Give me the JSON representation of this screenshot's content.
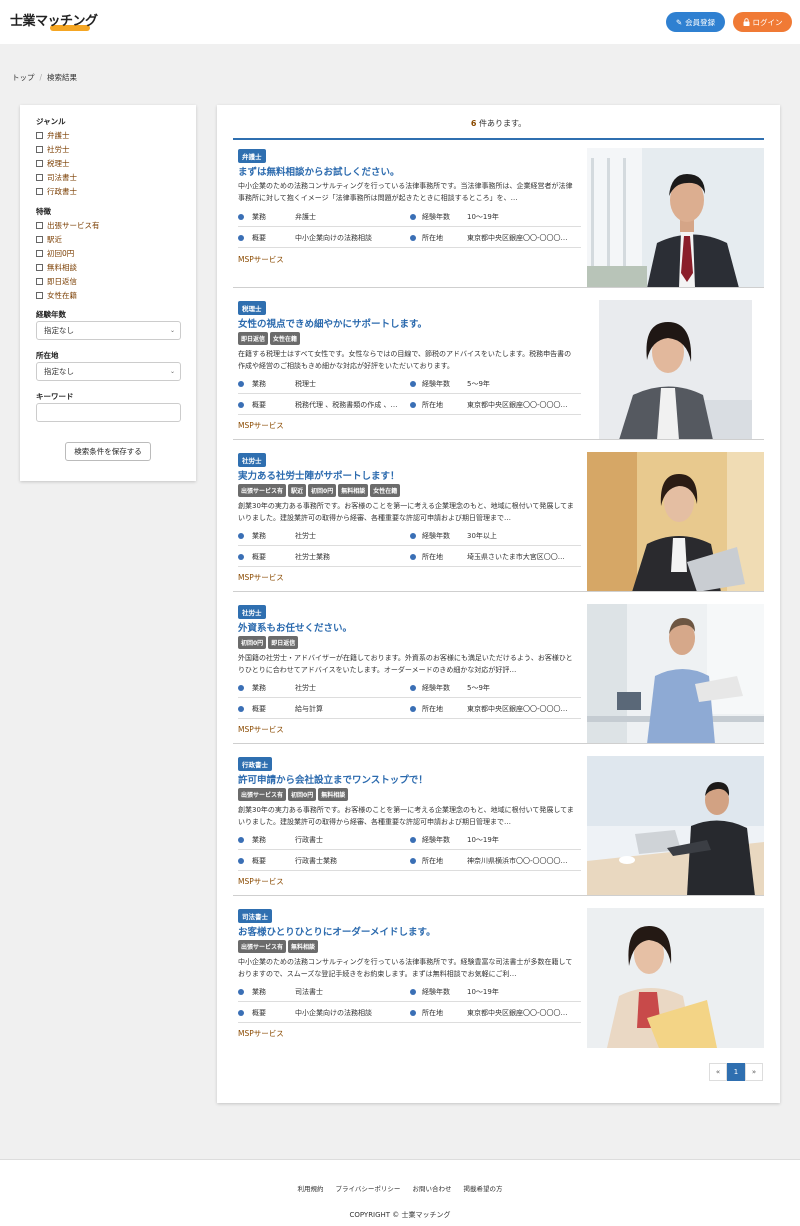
{
  "header": {
    "logo_text": "士業マッチング",
    "register_label": "会員登録",
    "login_label": "ログイン",
    "brand_color": "#f5a623"
  },
  "breadcrumb": [
    "トップ",
    "検索結果"
  ],
  "sidebar": {
    "genre_title": "ジャンル",
    "genres": [
      "弁護士",
      "社労士",
      "税理士",
      "司法書士",
      "行政書士"
    ],
    "feature_title": "特徴",
    "features": [
      "出張サービス有",
      "駅近",
      "初回0円",
      "無料相談",
      "即日返信",
      "女性在籍"
    ],
    "experience_title": "経験年数",
    "experience_selected": "指定なし",
    "location_title": "所在地",
    "location_selected": "指定なし",
    "keyword_title": "キーワード",
    "save_label": "検索条件を保存する"
  },
  "results": {
    "count": "6",
    "count_suffix": "件あります。",
    "labels": {
      "business": "業務",
      "experience": "経験年数",
      "overview": "概要",
      "location": "所在地"
    },
    "cards": [
      {
        "badge": "弁護士",
        "title": "まずは無料相談からお試しください。",
        "tags": [],
        "desc": "中小企業のための法務コンサルティングを行っている法律事務所です。当法律事務所は、企業経営者が法律事務所に対して抱くイメージ「法律事務所は問題が起きたときに相談するところ」を、…",
        "business": "弁護士",
        "experience": "10〜19年",
        "overview": "中小企業向けの法務相談",
        "location": "東京都中央区銀座〇〇-〇〇〇…",
        "service": "MSPサービス"
      },
      {
        "badge": "税理士",
        "title": "女性の視点できめ細やかにサポートします。",
        "tags": [
          "即日返信",
          "女性在籍"
        ],
        "desc": "在籍する税理士はすべて女性です。女性ならではの目線で、節税のアドバイスをいたします。税務申告書の作成や経営のご相談もきめ細かな対応が好評をいただいております。",
        "business": "税理士",
        "experience": "5〜9年",
        "overview": "税務代理 、税務書類の作成 、…",
        "location": "東京都中央区銀座〇〇-〇〇〇…",
        "service": "MSPサービス"
      },
      {
        "badge": "社労士",
        "title": "実力ある社労士陣がサポートします！",
        "tags": [
          "出張サービス有",
          "駅近",
          "初回0円",
          "無料相談",
          "女性在籍"
        ],
        "desc": "創業30年の実力ある事務所です。お客様のことを第一に考える企業理念のもと、地域に根付いて発展してまいりました。建設業許可の取得から経審、各種重要な許認可申請および期日管理まで…",
        "business": "社労士",
        "experience": "30年以上",
        "overview": "社労士業務",
        "location": "埼玉県さいたま市大宮区〇〇…",
        "service": "MSPサービス"
      },
      {
        "badge": "社労士",
        "title": "外資系もお任せください。",
        "tags": [
          "初回0円",
          "即日返信"
        ],
        "desc": "外国籍の社労士・アドバイザーが在籍しております。外資系のお客様にも満足いただけるよう、お客様ひとりひとりに合わせてアドバイスをいたします。オーダーメードのきめ細かな対応が好評…",
        "business": "社労士",
        "experience": "5〜9年",
        "overview": "給与計算",
        "location": "東京都中央区銀座〇〇-〇〇〇…",
        "service": "MSPサービス"
      },
      {
        "badge": "行政書士",
        "title": "許可申請から会社設立までワンストップで！",
        "tags": [
          "出張サービス有",
          "初回0円",
          "無料相談"
        ],
        "desc": "創業30年の実力ある事務所です。お客様のことを第一に考える企業理念のもと、地域に根付いて発展してまいりました。建設業許可の取得から経審、各種重要な許認可申請および期日管理まで…",
        "business": "行政書士",
        "experience": "10〜19年",
        "overview": "行政書士業務",
        "location": "神奈川県横浜市〇〇-〇〇〇〇…",
        "service": "MSPサービス"
      },
      {
        "badge": "司法書士",
        "title": "お客様ひとりひとりにオーダーメイドします。",
        "tags": [
          "出張サービス有",
          "無料相談"
        ],
        "desc": "中小企業のための法務コンサルティングを行っている法律事務所です。経験豊富な司法書士が多数在籍しておりますので、スムーズな登記手続きをお約束します。まずは無料相談でお気軽にご利…",
        "business": "司法書士",
        "experience": "10〜19年",
        "overview": "中小企業向けの法務相談",
        "location": "東京都中央区銀座〇〇-〇〇〇…",
        "service": "MSPサービス"
      }
    ]
  },
  "pagination": {
    "prev": "«",
    "current": "1",
    "next": "»"
  },
  "footer": {
    "links": [
      "利用規約",
      "プライバシーポリシー",
      "お問い合わせ",
      "掲載希望の方"
    ],
    "copyright": "COPYRIGHT © 士業マッチング"
  }
}
